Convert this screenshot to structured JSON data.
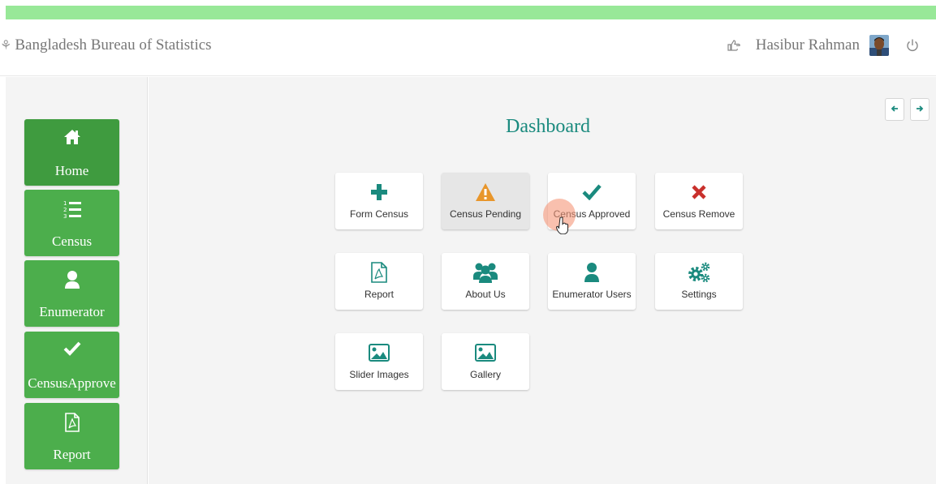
{
  "colors": {
    "top_stripe": "#98e898",
    "sidebar_green": "#4cae4c",
    "sidebar_active": "#3f9b3f",
    "teal": "#1a8a7e",
    "warning": "#f0ad4e",
    "danger": "#c9302c"
  },
  "navbar": {
    "brand_icon": "bangladesh-emblem-icon",
    "brand": "Bangladesh Bureau of Statistics",
    "username": "Hasibur Rahman",
    "pointer_icon": "hand-point-right-icon",
    "avatar_icon": "user-avatar",
    "power_icon": "power-icon"
  },
  "sidebar": {
    "items": [
      {
        "label": "Home",
        "icon": "home-icon"
      },
      {
        "label": "Census",
        "icon": "list-ol-icon"
      },
      {
        "label": "Enumerator",
        "icon": "user-icon"
      },
      {
        "label": "CensusApprove",
        "icon": "check-icon"
      },
      {
        "label": "Report",
        "icon": "file-pdf-icon"
      }
    ]
  },
  "main": {
    "title": "Dashboard",
    "nav_prev_icon": "arrow-left-icon",
    "nav_next_icon": "arrow-right-icon",
    "tiles": [
      {
        "label": "Form Census",
        "icon": "plus-icon"
      },
      {
        "label": "Census Pending",
        "icon": "warning-icon"
      },
      {
        "label": "Census Approved",
        "icon": "check-icon"
      },
      {
        "label": "Census Remove",
        "icon": "times-icon"
      },
      {
        "label": "Report",
        "icon": "file-pdf-icon"
      },
      {
        "label": "About Us",
        "icon": "users-icon"
      },
      {
        "label": "Enumerator Users",
        "icon": "user-icon"
      },
      {
        "label": "Settings",
        "icon": "cogs-icon"
      },
      {
        "label": "Slider Images",
        "icon": "image-icon"
      },
      {
        "label": "Gallery",
        "icon": "image-icon"
      }
    ]
  }
}
